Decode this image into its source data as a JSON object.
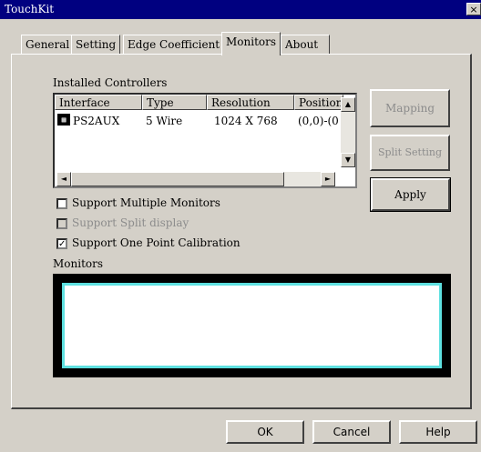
{
  "window": {
    "title": "TouchKit",
    "close_label": "×"
  },
  "tabs": [
    {
      "label": "General",
      "active": false
    },
    {
      "label": "Setting",
      "active": false
    },
    {
      "label": "Edge Coefficient",
      "active": false
    },
    {
      "label": "Monitors",
      "active": true
    },
    {
      "label": "About",
      "active": false
    }
  ],
  "installed_controllers": {
    "label": "Installed Controllers",
    "columns": [
      "Interface",
      "Type",
      "Resolution",
      "Position"
    ],
    "rows": [
      {
        "interface": "PS2AUX",
        "type": "5 Wire",
        "resolution": "1024 X 768",
        "position": "(0,0)-(0"
      }
    ]
  },
  "side_buttons": {
    "mapping": "Mapping",
    "split_setting": "Split Setting",
    "apply": "Apply"
  },
  "options": {
    "multi_monitors": {
      "label": "Support Multiple Monitors",
      "checked": false
    },
    "split_display": {
      "label": "Support Split display",
      "checked": false,
      "disabled": true
    },
    "one_point": {
      "label": "Support One Point Calibration",
      "checked": true,
      "check_mark": "✓"
    }
  },
  "monitors": {
    "label": "Monitors"
  },
  "footer": {
    "ok": "OK",
    "cancel": "Cancel",
    "help": "Help"
  },
  "icons": {
    "up": "▲",
    "down": "▼",
    "left": "◄",
    "right": "►"
  },
  "colors": {
    "titlebar": "#000080",
    "face": "#d4d0c8",
    "monitor_border": "#5ee0e0"
  }
}
